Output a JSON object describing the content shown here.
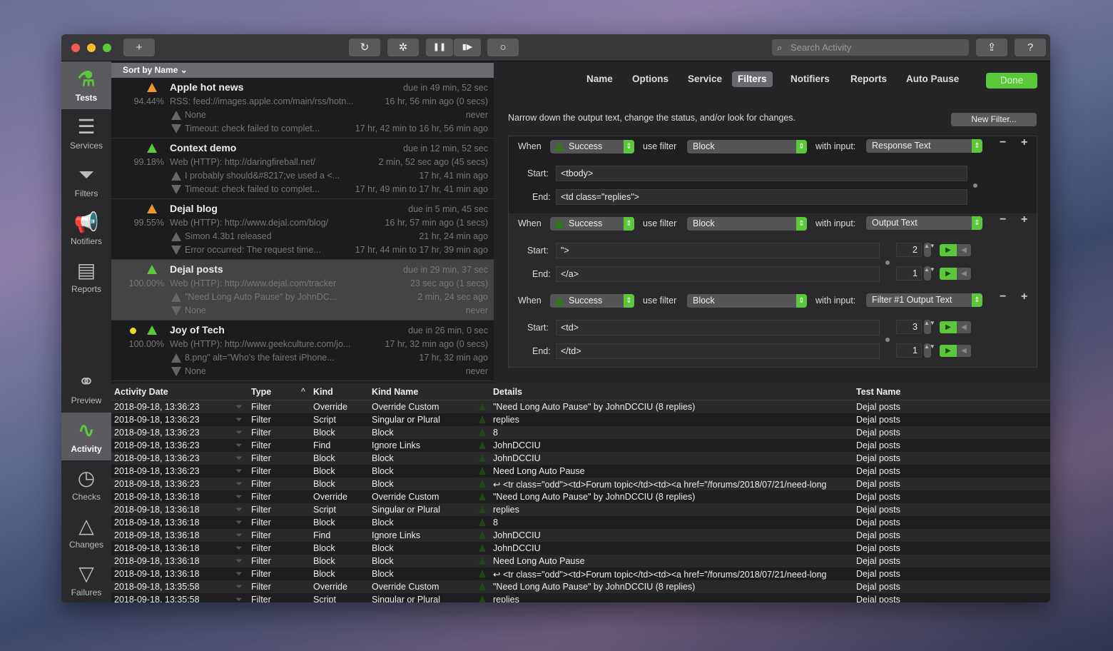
{
  "toolbar": {
    "add": "+",
    "refresh": "↻",
    "disable": "✲",
    "pause": "❚❚",
    "step": "▮▶",
    "stop": "○",
    "search_placeholder": "Search Activity",
    "share": "⇪",
    "help": "?"
  },
  "colors": {
    "accent": "#5ac83a",
    "warning": "#f0952a",
    "yellow": "#e8d92a"
  },
  "sidebar": {
    "items": [
      {
        "label": "Tests",
        "icon": "flask-icon",
        "glyph": "⚗"
      },
      {
        "label": "Services",
        "icon": "database-icon",
        "glyph": "☰"
      },
      {
        "label": "Filters",
        "icon": "filter-icon",
        "glyph": "⏷"
      },
      {
        "label": "Notifiers",
        "icon": "megaphone-icon",
        "glyph": "📢"
      },
      {
        "label": "Reports",
        "icon": "report-icon",
        "glyph": "▤"
      },
      {
        "label": "Preview",
        "icon": "binoculars-icon",
        "glyph": "⚭"
      },
      {
        "label": "Activity",
        "icon": "activity-icon",
        "glyph": "∿"
      },
      {
        "label": "Checks",
        "icon": "stopwatch-icon",
        "glyph": "◷"
      },
      {
        "label": "Changes",
        "icon": "triangle-up-icon",
        "glyph": "△"
      },
      {
        "label": "Failures",
        "icon": "triangle-down-icon",
        "glyph": "▽"
      }
    ]
  },
  "tests": {
    "sort_label": "Sort by Name ⌄",
    "items": [
      {
        "name": "Apple hot news",
        "status": "warning",
        "pct": "94.44%",
        "service": "RSS: feed://images.apple.com/main/rss/hotn...",
        "due": "due in 49 min, 52 sec",
        "last": "16 hr, 56 min ago (0 secs)",
        "change": "None",
        "change_time": "never",
        "fail": "Timeout: check failed to complet...",
        "fail_time": "17 hr, 42 min to 16 hr, 56 min ago"
      },
      {
        "name": "Context demo",
        "status": "success",
        "pct": "99.18%",
        "service": "Web (HTTP): http://daringfireball.net/",
        "due": "due in 12 min, 52 sec",
        "last": "2 min, 52 sec ago (45 secs)",
        "change": "I probably should&#8217;ve used a <...",
        "change_time": "17 hr, 41 min ago",
        "fail": "Timeout: check failed to complet...",
        "fail_time": "17 hr, 49 min to 17 hr, 41 min ago"
      },
      {
        "name": "Dejal blog",
        "status": "warning",
        "pct": "99.55%",
        "service": "Web (HTTP): http://www.dejal.com/blog/",
        "due": "due in 5 min, 45 sec",
        "last": "16 hr, 57 min ago (1 secs)",
        "change": "Simon 4.3b1 released",
        "change_time": "21 hr, 24 min ago",
        "fail": "Error occurred: The request time...",
        "fail_time": "17 hr, 44 min to 17 hr, 39 min ago"
      },
      {
        "name": "Dejal posts",
        "status": "success",
        "selected": true,
        "pct": "100.00%",
        "service": "Web (HTTP): http://www.dejal.com/tracker",
        "due": "due in 29 min, 37 sec",
        "last": "23 sec ago (1 secs)",
        "change": "\"Need Long Auto Pause\" by JohnDC...",
        "change_time": "2 min, 24 sec ago",
        "fail": "None",
        "fail_time": "never"
      },
      {
        "name": "Joy of Tech",
        "status": "success",
        "dot": true,
        "pct": "100.00%",
        "service": "Web (HTTP): http://www.geekculture.com/jo...",
        "due": "due in 26 min, 0 sec",
        "last": "17 hr, 32 min ago (0 secs)",
        "change": "8.png\" alt=\"Who's the fairest iPhone...",
        "change_time": "17 hr, 32 min ago",
        "fail": "None",
        "fail_time": "never"
      }
    ]
  },
  "tabs": [
    "Name",
    "Options",
    "Service",
    "Filters",
    "Notifiers",
    "Reports",
    "Auto Pause"
  ],
  "selected_tab": "Filters",
  "done_label": "Done",
  "filters": {
    "description": "Narrow down the output text, change the status, and/or look for changes.",
    "new_filter": "New Filter...",
    "when_label": "When",
    "use_filter_label": "use filter",
    "with_input_label": "with input:",
    "start_label": "Start:",
    "end_label": "End:",
    "rows": [
      {
        "when": "Success",
        "filter": "Block",
        "input": "Response Text",
        "start": "<tbody>",
        "end": "<td class=\"replies\">"
      },
      {
        "when": "Success",
        "filter": "Block",
        "input": "Output Text",
        "start": "\">",
        "end": "</a>",
        "start_count": "2",
        "end_count": "1"
      },
      {
        "when": "Success",
        "filter": "Block",
        "input": "Filter #1 Output Text",
        "start": "<td>",
        "end": "</td>",
        "start_count": "3",
        "end_count": "1"
      }
    ]
  },
  "activity": {
    "columns": [
      "Activity Date",
      "Type",
      "Kind",
      "Kind Name",
      "Details",
      "Test Name"
    ],
    "sort_indicator": "^",
    "rows": [
      [
        "2018-09-18, 13:36:23",
        "Filter",
        "Override",
        "Override Custom",
        "\"Need Long Auto Pause\" by JohnDCCIU (8 replies)",
        "Dejal posts"
      ],
      [
        "2018-09-18, 13:36:23",
        "Filter",
        "Script",
        "Singular or Plural",
        "replies",
        "Dejal posts"
      ],
      [
        "2018-09-18, 13:36:23",
        "Filter",
        "Block",
        "Block",
        "8",
        "Dejal posts"
      ],
      [
        "2018-09-18, 13:36:23",
        "Filter",
        "Find",
        "Ignore Links",
        "JohnDCCIU",
        "Dejal posts"
      ],
      [
        "2018-09-18, 13:36:23",
        "Filter",
        "Block",
        "Block",
        "JohnDCCIU",
        "Dejal posts"
      ],
      [
        "2018-09-18, 13:36:23",
        "Filter",
        "Block",
        "Block",
        "Need Long Auto Pause",
        "Dejal posts"
      ],
      [
        "2018-09-18, 13:36:23",
        "Filter",
        "Block",
        "Block",
        "↩ <tr class=\"odd\"><td>Forum topic</td><td><a href=\"/forums/2018/07/21/need-long",
        "Dejal posts"
      ],
      [
        "2018-09-18, 13:36:18",
        "Filter",
        "Override",
        "Override Custom",
        "\"Need Long Auto Pause\" by JohnDCCIU (8 replies)",
        "Dejal posts"
      ],
      [
        "2018-09-18, 13:36:18",
        "Filter",
        "Script",
        "Singular or Plural",
        "replies",
        "Dejal posts"
      ],
      [
        "2018-09-18, 13:36:18",
        "Filter",
        "Block",
        "Block",
        "8",
        "Dejal posts"
      ],
      [
        "2018-09-18, 13:36:18",
        "Filter",
        "Find",
        "Ignore Links",
        "JohnDCCIU",
        "Dejal posts"
      ],
      [
        "2018-09-18, 13:36:18",
        "Filter",
        "Block",
        "Block",
        "JohnDCCIU",
        "Dejal posts"
      ],
      [
        "2018-09-18, 13:36:18",
        "Filter",
        "Block",
        "Block",
        "Need Long Auto Pause",
        "Dejal posts"
      ],
      [
        "2018-09-18, 13:36:18",
        "Filter",
        "Block",
        "Block",
        "↩ <tr class=\"odd\"><td>Forum topic</td><td><a href=\"/forums/2018/07/21/need-long",
        "Dejal posts"
      ],
      [
        "2018-09-18, 13:35:58",
        "Filter",
        "Override",
        "Override Custom",
        "\"Need Long Auto Pause\" by JohnDCCIU (8 replies)",
        "Dejal posts"
      ],
      [
        "2018-09-18, 13:35:58",
        "Filter",
        "Script",
        "Singular or Plural",
        "replies",
        "Dejal posts"
      ]
    ]
  }
}
